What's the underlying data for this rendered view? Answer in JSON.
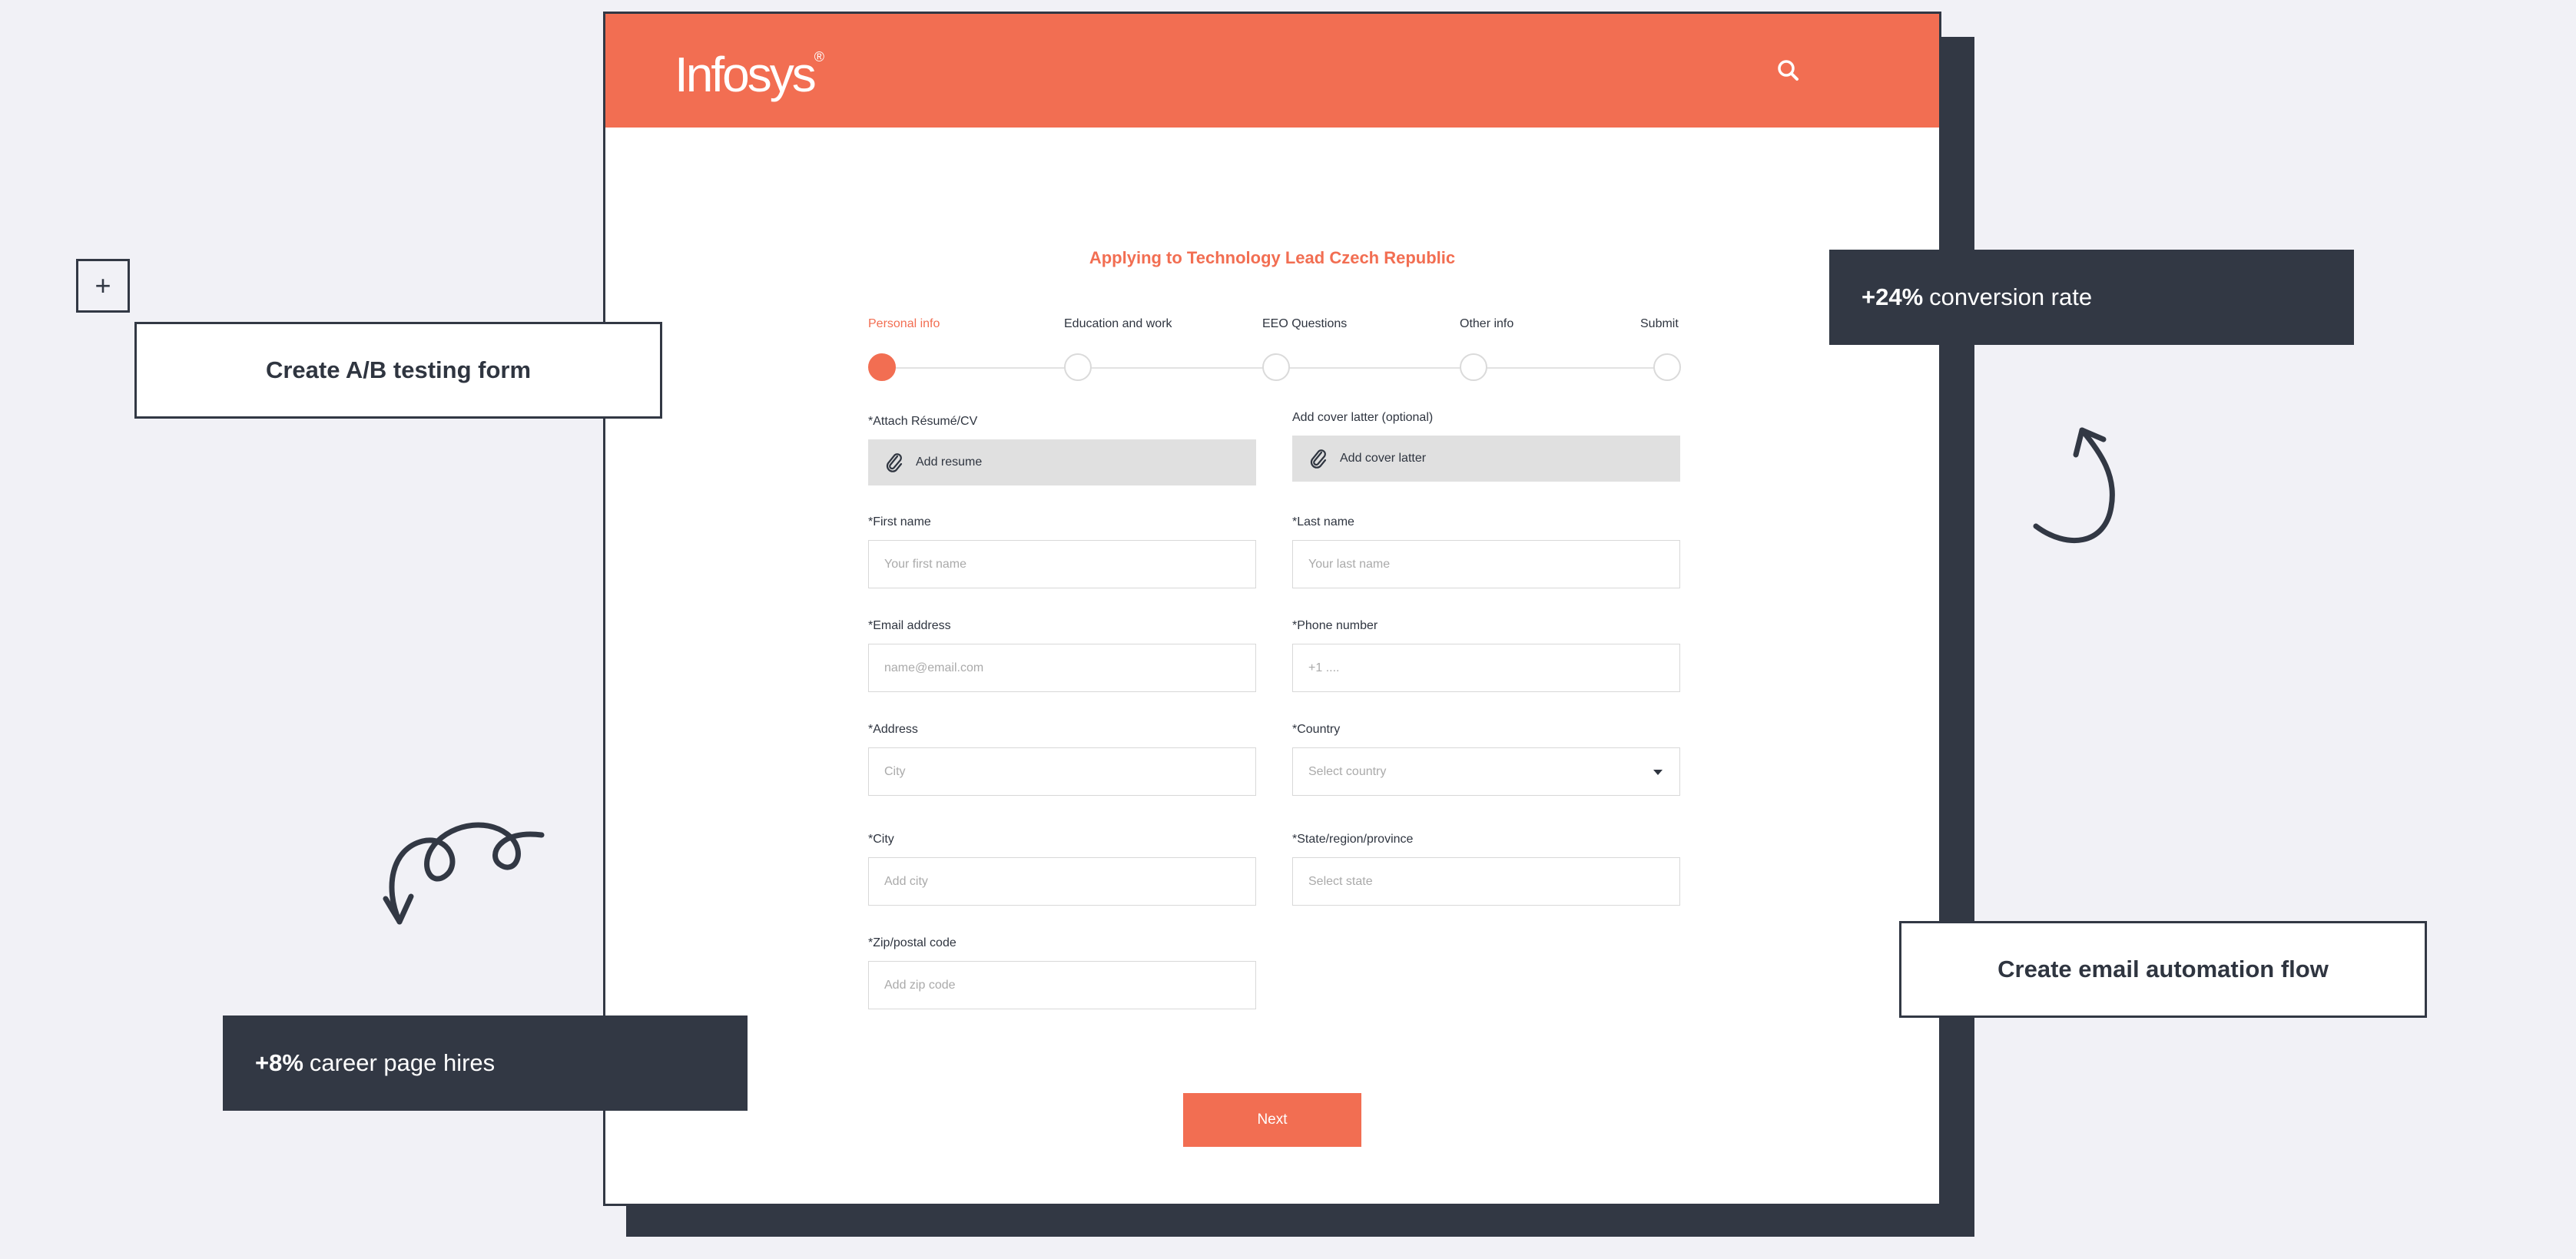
{
  "brand": {
    "logo_text": "Infosys",
    "logo_mark": "®",
    "accent_color": "#f26e52",
    "dark_color": "#323844"
  },
  "header": {
    "search_icon": "search-icon"
  },
  "form": {
    "title": "Applying to Technology Lead Czech Republic",
    "steps": [
      {
        "label": "Personal info",
        "active": true
      },
      {
        "label": "Education and work",
        "active": false
      },
      {
        "label": "EEO Questions",
        "active": false
      },
      {
        "label": "Other info",
        "active": false
      },
      {
        "label": "Submit",
        "active": false
      }
    ],
    "resume": {
      "label": "*Attach Résumé/CV",
      "button": "Add resume",
      "icon": "paperclip-icon"
    },
    "cover": {
      "label": "Add cover latter (optional)",
      "button": "Add cover latter",
      "icon": "paperclip-icon"
    },
    "first_name": {
      "label": "*First name",
      "placeholder": "Your first name"
    },
    "last_name": {
      "label": "*Last name",
      "placeholder": "Your last name"
    },
    "email": {
      "label": "*Email address",
      "placeholder": "name@email.com"
    },
    "phone": {
      "label": "*Phone number",
      "placeholder": "+1 ...."
    },
    "address": {
      "label": "*Address",
      "placeholder": "City"
    },
    "country": {
      "label": "*Country",
      "placeholder": "Select country"
    },
    "city": {
      "label": "*City",
      "placeholder": "Add city"
    },
    "state": {
      "label": "*State/region/province",
      "placeholder": "Select state"
    },
    "zip": {
      "label": "*Zip/postal code",
      "placeholder": "Add zip code"
    },
    "next_label": "Next"
  },
  "callouts": {
    "ab_testing": "Create A/B testing form",
    "email_flow": "Create email automation flow",
    "conversion_value": "+24%",
    "conversion_text": "conversion rate",
    "hires_value": "+8%",
    "hires_text": "career page hires",
    "plus_symbol": "+"
  }
}
